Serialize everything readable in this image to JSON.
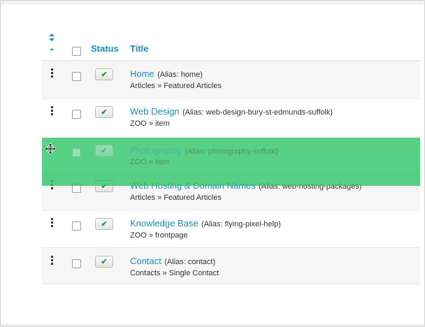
{
  "table": {
    "headers": {
      "status": "Status",
      "title": "Title"
    },
    "rows": [
      {
        "title": "Home",
        "alias": "(Alias: home)",
        "path": "Articles » Featured Articles",
        "status": "✔"
      },
      {
        "title": "Web Design",
        "alias": "(Alias: web-design-bury-st-edmunds-suffolk)",
        "path": "ZOO » item",
        "status": "✔"
      },
      {
        "title": "Web Hosting & Domain Names",
        "alias": "(Alias: web-hosting-packages)",
        "path": "Articles » Featured Articles",
        "status": "✔"
      },
      {
        "title": "Knowledge Base",
        "alias": "(Alias: flying-pixel-help)",
        "path": "ZOO » frontpage",
        "status": "✔"
      },
      {
        "title": "Contact",
        "alias": "(Alias: contact)",
        "path": "Contacts » Single Contact",
        "status": "✔"
      }
    ],
    "dragging": {
      "title": "Photography",
      "alias": "(Alias: photography-suffolk)",
      "path": "ZOO » item",
      "status": "✔"
    }
  },
  "colors": {
    "link": "#1a8ec2",
    "drag_highlight": "#2ec466",
    "published": "#2e9a3b"
  },
  "icons": {
    "sort": "sort-arrows-icon",
    "handle": "drag-handle-icon",
    "status": "check-icon",
    "cursor": "move-cursor-icon"
  }
}
